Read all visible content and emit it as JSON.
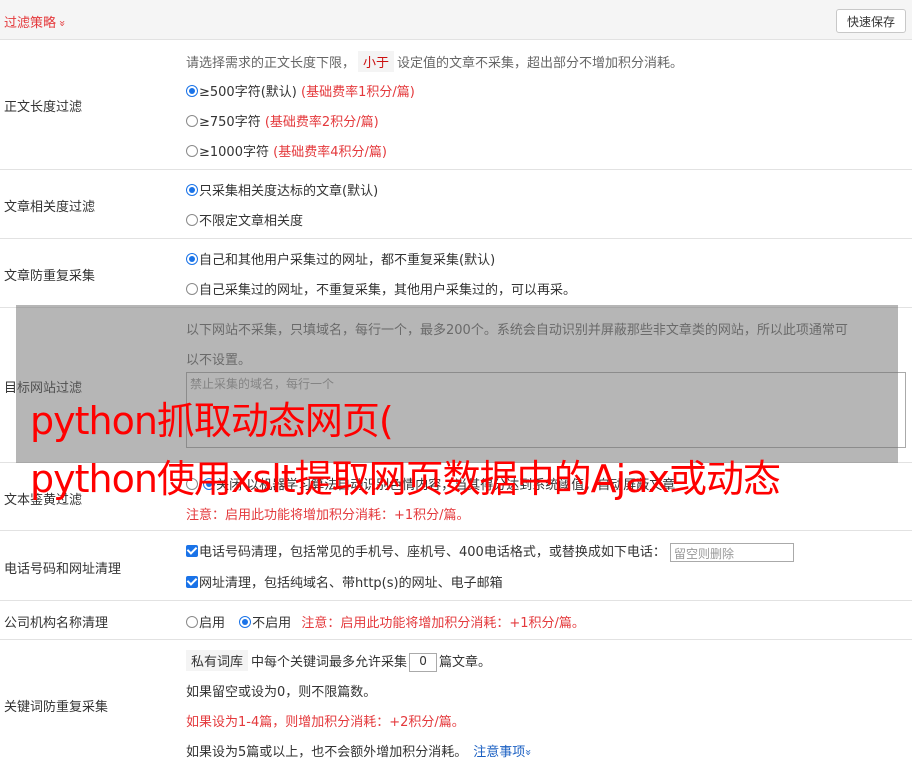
{
  "header": {
    "title": "过滤策略",
    "chevron": "»",
    "save_label": "快速保存"
  },
  "length_filter": {
    "label": "正文长度过滤",
    "desc_pre": "请选择需求的正文长度下限，",
    "desc_tag": "小于",
    "desc_post": "设定值的文章不采集，超出部分不增加积分消耗。",
    "options": [
      {
        "text": "≥500字符(默认)",
        "rate": "(基础费率1积分/篇)",
        "selected": true
      },
      {
        "text": "≥750字符",
        "rate": "(基础费率2积分/篇)",
        "selected": false
      },
      {
        "text": "≥1000字符",
        "rate": "(基础费率4积分/篇)",
        "selected": false
      }
    ]
  },
  "relevance": {
    "label": "文章相关度过滤",
    "options": [
      {
        "text": "只采集相关度达标的文章(默认)"
      },
      {
        "text": "不限定文章相关度"
      }
    ]
  },
  "dedup": {
    "label": "文章防重复采集",
    "options": [
      {
        "text": "自己和其他用户采集过的网址，都不重复采集(默认)"
      },
      {
        "text": "自己采集过的网址，不重复采集，其他用户采集过的，可以再采。"
      }
    ]
  },
  "site_filter": {
    "label": "目标网站过滤",
    "desc1": "以下网站不采集，只填域名，每行一个，最多200个。系统会自动识别并屏蔽那些非文章类的网站，所以此项通常可",
    "desc2": "以不设置。",
    "placeholder": "禁止采集的域名，每行一个"
  },
  "porn_filter": {
    "label": "文本鉴黄过滤",
    "opt1": "关闭",
    "text": "以机器学习算法自动识别色情内容，当其得分达到系统阈值，自动屏蔽文章",
    "note": "注意：启用此功能将增加积分消耗：+1积分/篇。"
  },
  "phone_url": {
    "label": "电话号码和网址清理",
    "phone_text": "电话号码清理，包括常见的手机号、座机号、400电话格式，或替换成如下电话：",
    "phone_placeholder": "留空则删除",
    "url_text": "网址清理，包括纯域名、带http(s)的网址、电子邮箱"
  },
  "org_name": {
    "label": "公司机构名称清理",
    "opt_on": "启用",
    "opt_off": "不启用",
    "note": "注意：启用此功能将增加积分消耗：+1积分/篇。"
  },
  "keyword_dedup": {
    "label": "关键词防重复采集",
    "tag": "私有词库",
    "text_pre": "中每个关键词最多允许采集",
    "value": "0",
    "text_post": "篇文章。",
    "line2": "如果留空或设为0，则不限篇数。",
    "line3": "如果设为1-4篇，则增加积分消耗：+2积分/篇。",
    "line4": "如果设为5篇或以上，也不会额外增加积分消耗。",
    "link": "注意事项",
    "link_chev": "»"
  },
  "overlay": {
    "line1": "python抓取动态网页(",
    "line2": "python使用xslt提取网页数据中的Ajax或动态"
  },
  "colors": {
    "accent_red": "#e4393c",
    "overlay_red": "#ff0000",
    "radio_blue": "#1a73e8",
    "link_blue": "#1a5fc2"
  }
}
